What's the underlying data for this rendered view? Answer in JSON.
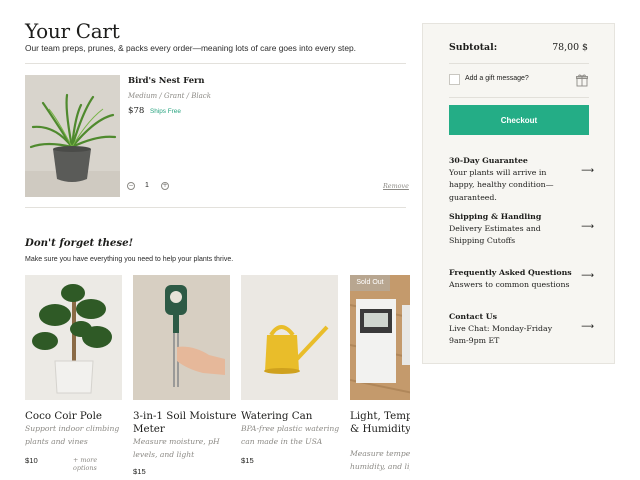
{
  "cart": {
    "title": "Your Cart",
    "subtitle": "Our team preps, prunes, & packs every order—meaning lots of care goes into every step."
  },
  "item": {
    "name": "Bird's Nest Fern",
    "variant": "Medium / Grant / Black",
    "price": "$78",
    "shipping": "Ships Free",
    "quantity": "1",
    "remove_label": "Remove",
    "decrement_icon": "minus-circle-icon",
    "increment_icon": "plus-circle-icon"
  },
  "recommendations": {
    "title": "Don't forget these!",
    "subtitle": "Make sure you have everything you need to help your plants thrive.",
    "items": [
      {
        "name": "Coco Coir Pole",
        "description": "Support indoor climbing plants and vines",
        "price": "$10",
        "more": "+ more options"
      },
      {
        "name": "3-in-1 Soil Moisture Meter",
        "description": "Measure moisture, pH levels, and light",
        "price": "$15"
      },
      {
        "name": "Watering Can",
        "description": "BPA-free plastic watering can made in the USA",
        "price": "$15"
      },
      {
        "name": "Light, Temperature & Humidity Meter",
        "description": "Measure temperature, humidity, and light",
        "badge": "Sold Out"
      }
    ]
  },
  "summary": {
    "subtotal_label": "Subtotal:",
    "subtotal_value": "78,00 $",
    "gift_label": "Add a gift message?",
    "gift_icon": "gift-icon",
    "checkout_label": "Checkout",
    "info": [
      {
        "title": "30-Day Guarantee",
        "text": "Your plants will arrive in happy, healthy condition—guaranteed."
      },
      {
        "title": "Shipping & Handling",
        "text": "Delivery Estimates and Shipping Cutoffs"
      },
      {
        "title": "Frequently Asked Questions",
        "text": "Answers to common questions"
      },
      {
        "title": "Contact Us",
        "text": "Live Chat: Monday-Friday 9am-9pm ET"
      }
    ],
    "arrow_icon": "arrow-right-icon"
  },
  "colors": {
    "accent": "#24ad86",
    "ships_free": "#27a37f",
    "sidebar_bg": "#f7f6f2",
    "muted_text": "#8c8a85"
  }
}
